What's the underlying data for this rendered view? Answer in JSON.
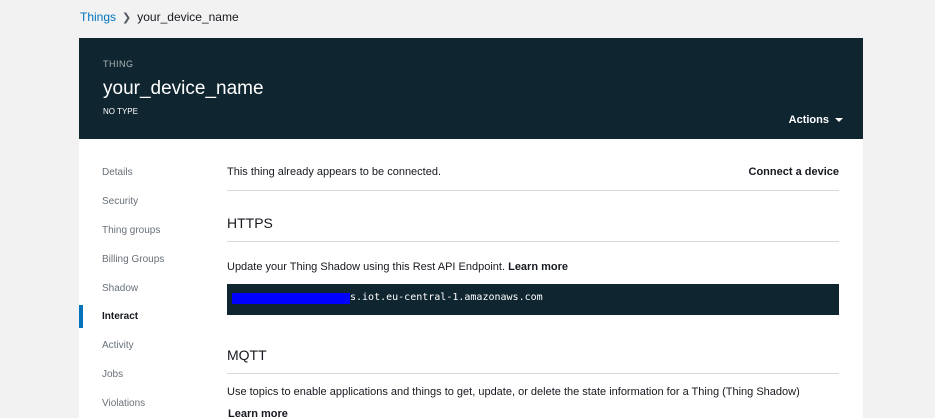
{
  "breadcrumb": {
    "root": "Things",
    "current": "your_device_name"
  },
  "header": {
    "kind": "THING",
    "title": "your_device_name",
    "type": "NO TYPE",
    "actions_label": "Actions"
  },
  "sidebar": {
    "items": [
      {
        "label": "Details"
      },
      {
        "label": "Security"
      },
      {
        "label": "Thing groups"
      },
      {
        "label": "Billing Groups"
      },
      {
        "label": "Shadow"
      },
      {
        "label": "Interact"
      },
      {
        "label": "Activity"
      },
      {
        "label": "Jobs"
      },
      {
        "label": "Violations"
      }
    ],
    "active": "Interact"
  },
  "content": {
    "status_text": "This thing already appears to be connected.",
    "connect_label": "Connect a device",
    "https": {
      "title": "HTTPS",
      "description": "Update your Thing Shadow using this Rest API Endpoint.",
      "learn_more": "Learn more",
      "endpoint_suffix": "s.iot.eu-central-1.amazonaws.com"
    },
    "mqtt": {
      "title": "MQTT",
      "description": "Use topics to enable applications and things to get, update, or delete the state information for a Thing (Thing Shadow)",
      "learn_more": "Learn more"
    }
  },
  "colors": {
    "header_bg": "#0f2530",
    "link": "#0073bb",
    "redaction": "#0000ff"
  }
}
